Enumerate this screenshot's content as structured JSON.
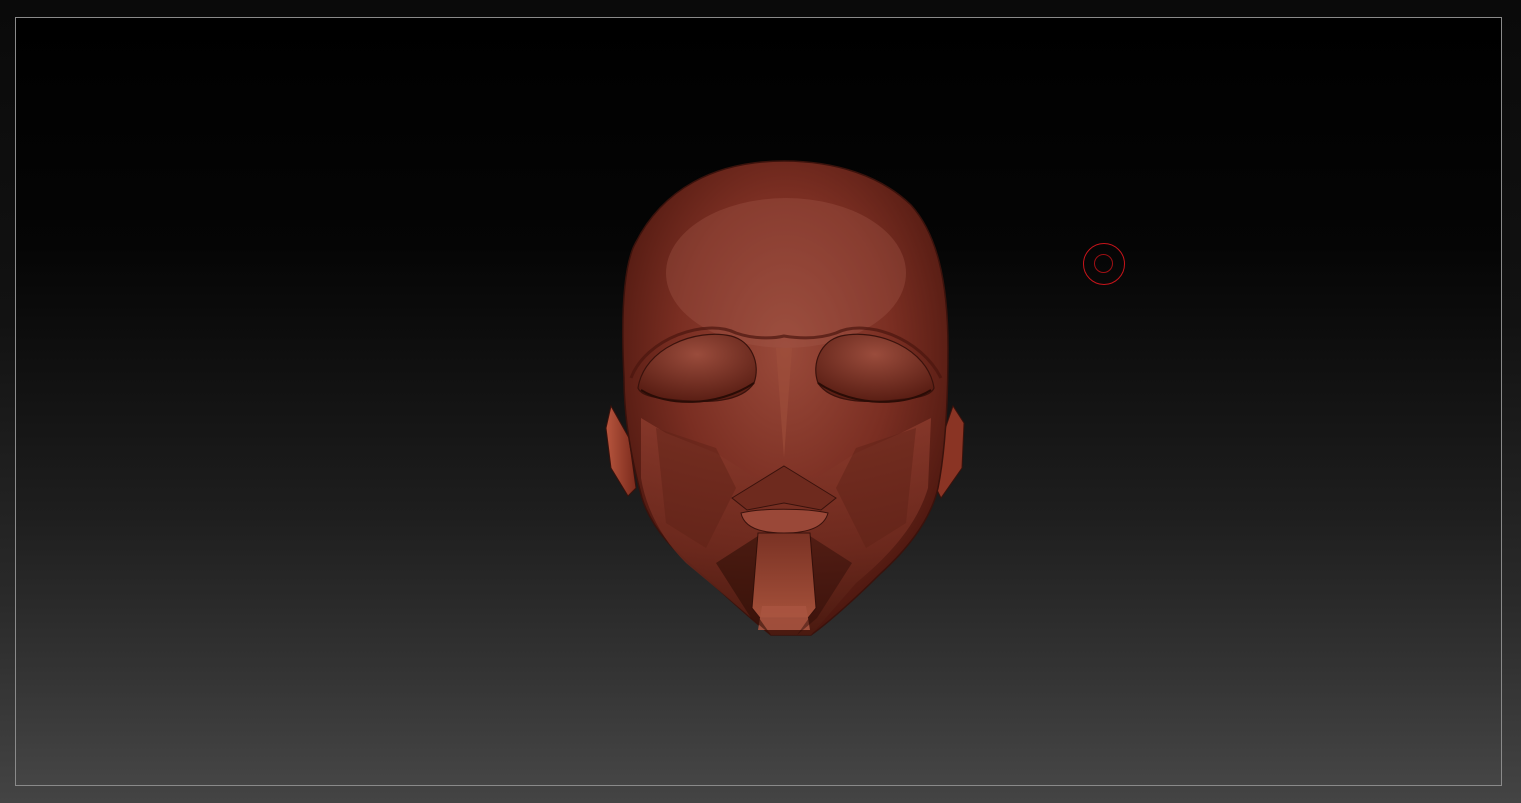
{
  "app": {
    "window": "3d-sculpting-canvas"
  },
  "canvas": {
    "background_top": "#000000",
    "background_bottom": "#454545",
    "frame_border": "#8a8a8a"
  },
  "model": {
    "subject": "head-mesh",
    "material_color": "#8a3a2a",
    "highlight_color": "#b4604a",
    "shadow_color": "#3a120c"
  },
  "cursor": {
    "type": "brush-cursor",
    "color": "#c8141a"
  }
}
